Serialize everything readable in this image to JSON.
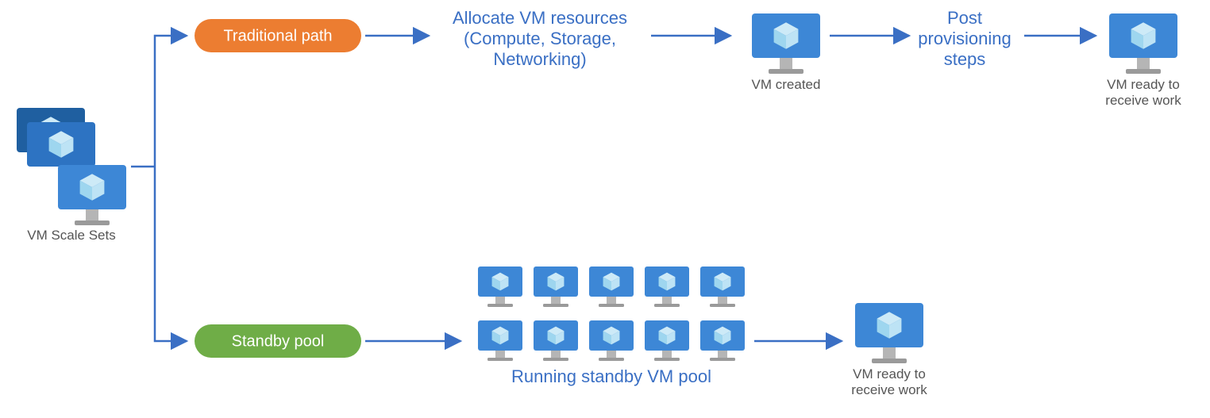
{
  "source": {
    "label": "VM Scale Sets"
  },
  "paths": {
    "traditional": {
      "label": "Traditional path",
      "color": "#ec7d31",
      "steps": {
        "allocate": "Allocate VM resources (Compute, Storage, Networking)",
        "created": "VM created",
        "post": "Post provisioning steps",
        "ready": "VM ready to receive work"
      }
    },
    "standby": {
      "label": "Standby pool",
      "color": "#6fad47",
      "pool_label": "Running standby VM pool",
      "ready": "VM ready to receive work"
    }
  },
  "icons": {
    "vm": "vm-azure-icon"
  },
  "colors": {
    "azure_blue": "#3d87d6",
    "azure_dark": "#1f5fa0",
    "azure_text": "#3a6fc4",
    "orange": "#ec7d31",
    "green": "#6fad47"
  }
}
